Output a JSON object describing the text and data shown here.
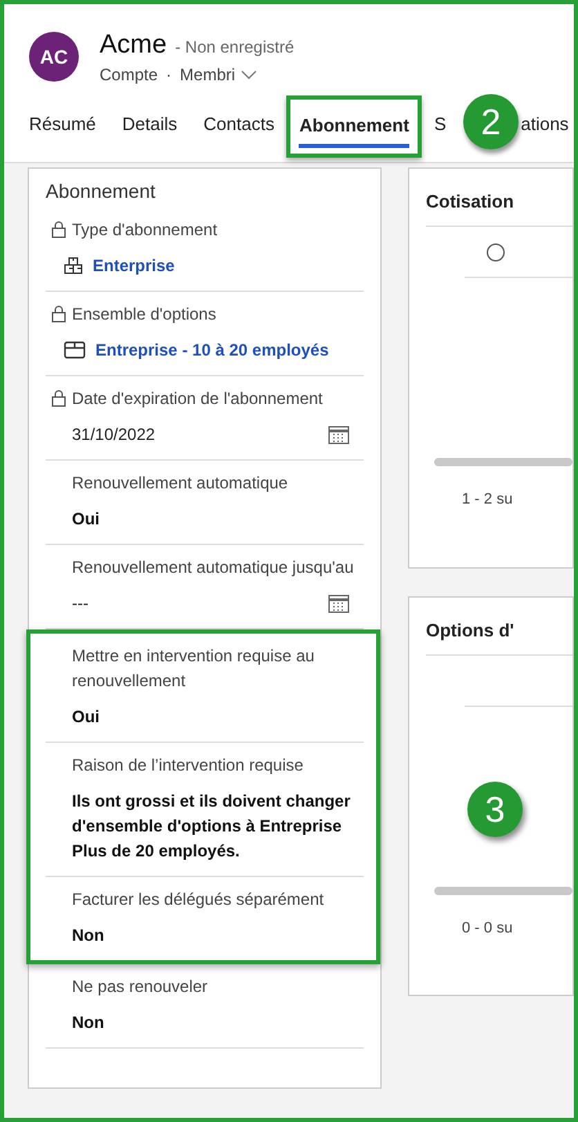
{
  "header": {
    "avatar_initials": "AC",
    "name": "Acme",
    "status": "- Non enregistré",
    "entity": "Compte",
    "separator": "·",
    "view": "Membri"
  },
  "tabs": [
    {
      "label": "Résumé",
      "selected": false,
      "highlighted": false
    },
    {
      "label": "Details",
      "selected": false,
      "highlighted": false
    },
    {
      "label": "Contacts",
      "selected": false,
      "highlighted": false
    },
    {
      "label": "Abonnement",
      "selected": true,
      "highlighted": true
    },
    {
      "label": "S",
      "label_tail": "ations",
      "selected": false,
      "highlighted": false
    }
  ],
  "callouts": [
    {
      "number": "2"
    },
    {
      "number": "3"
    }
  ],
  "section": {
    "title": "Abonnement",
    "fields": [
      {
        "label": "Type d'abonnement",
        "locked": true,
        "kind": "product",
        "value": "Enterprise",
        "calendar": false,
        "highlighted": false
      },
      {
        "label": "Ensemble d'options",
        "locked": true,
        "kind": "bundle",
        "value": "Entreprise - 10 à 20 employés",
        "calendar": false,
        "highlighted": false
      },
      {
        "label": "Date d'expiration de l'abonnement",
        "locked": true,
        "kind": "text",
        "value": "31/10/2022",
        "calendar": true,
        "highlighted": false
      },
      {
        "label": "Renouvellement automatique",
        "locked": false,
        "kind": "bold",
        "value": "Oui",
        "calendar": false,
        "highlighted": false
      },
      {
        "label": "Renouvellement automatique jusqu'au",
        "locked": false,
        "kind": "text",
        "value": "---",
        "calendar": true,
        "highlighted": false
      },
      {
        "label": "Mettre en intervention requise au renouvellement",
        "locked": false,
        "kind": "bold",
        "value": "Oui",
        "calendar": false,
        "highlighted": true
      },
      {
        "label": "Raison de l’intervention requise",
        "locked": false,
        "kind": "bold",
        "value": "Ils ont grossi et ils doivent changer d'ensemble d'options à Entreprise Plus de 20 employés.",
        "calendar": false,
        "highlighted": true
      },
      {
        "label": "Facturer les délégués séparément",
        "locked": false,
        "kind": "bold",
        "value": "Non",
        "calendar": false,
        "highlighted": true
      },
      {
        "label": "Ne pas renouveler",
        "locked": false,
        "kind": "bold",
        "value": "Non",
        "calendar": false,
        "highlighted": false
      }
    ]
  },
  "side_cards": [
    {
      "title": "Cotisation",
      "radio_selected": false,
      "footer": "1 - 2 su"
    },
    {
      "title": "Options d'",
      "footer": "0 - 0 su"
    }
  ]
}
